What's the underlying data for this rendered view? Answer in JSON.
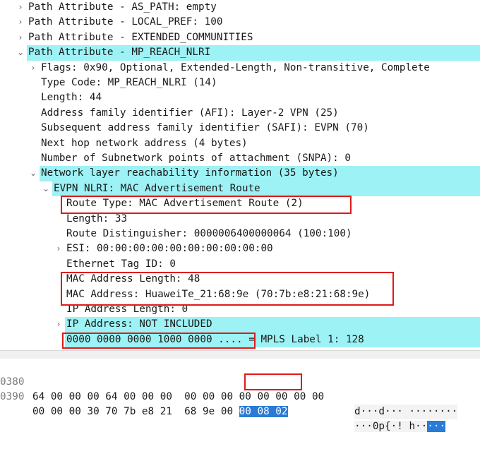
{
  "tree": [
    {
      "label": "Path Attribute - AS_PATH: empty",
      "arrow": "›"
    },
    {
      "label": "Path Attribute - LOCAL_PREF: 100",
      "arrow": "›"
    },
    {
      "label": "Path Attribute - EXTENDED_COMMUNITIES",
      "arrow": "›"
    },
    {
      "label": "Path Attribute - MP_REACH_NLRI",
      "arrow": "⌄"
    },
    {
      "label": "Flags: 0x90, Optional, Extended-Length, Non-transitive, Complete",
      "arrow": "›"
    },
    {
      "label": "Type Code: MP_REACH_NLRI (14)"
    },
    {
      "label": "Length: 44"
    },
    {
      "label": "Address family identifier (AFI): Layer-2 VPN (25)"
    },
    {
      "label": "Subsequent address family identifier (SAFI): EVPN (70)"
    },
    {
      "label": "Next hop network address (4 bytes)"
    },
    {
      "label": "Number of Subnetwork points of attachment (SNPA): 0"
    },
    {
      "label": "Network layer reachability information (35 bytes)",
      "arrow": "⌄"
    },
    {
      "label": "EVPN NLRI: MAC Advertisement Route",
      "arrow": "⌄"
    },
    {
      "label": "Route Type: MAC Advertisement Route (2)"
    },
    {
      "label": "Length: 33"
    },
    {
      "label": "Route Distinguisher: 0000006400000064 (100:100)"
    },
    {
      "label": "ESI: 00:00:00:00:00:00:00:00:00:00",
      "arrow": "›"
    },
    {
      "label": "Ethernet Tag ID: 0"
    },
    {
      "label": "MAC Address Length: 48"
    },
    {
      "label": "MAC Address: HuaweiTe_21:68:9e (70:7b:e8:21:68:9e)"
    },
    {
      "label": "IP Address Length: 0"
    },
    {
      "label": "IP Address: NOT INCLUDED",
      "arrow": "›"
    },
    {
      "label": "0000 0000 0000 1000 0000 .... = MPLS Label 1: 128"
    }
  ],
  "hex": [
    {
      "offset": "0380",
      "bytes": "64 00 00 00 64 00 00 00  00 00 00 00 00 00 00 00",
      "ascii": "d···d··· ········"
    },
    {
      "offset": "0390",
      "bytes": "00 00 00 30 70 7b e8 21  68 9e 00 ",
      "bytes_selected": "00 08 02",
      "ascii": "···0p{·! h··",
      "ascii_selected": "···"
    }
  ],
  "colors": {
    "selected_row": "#9cf2f5",
    "annotation_box": "#e01919",
    "hex_selection": "#2b7bd6"
  }
}
